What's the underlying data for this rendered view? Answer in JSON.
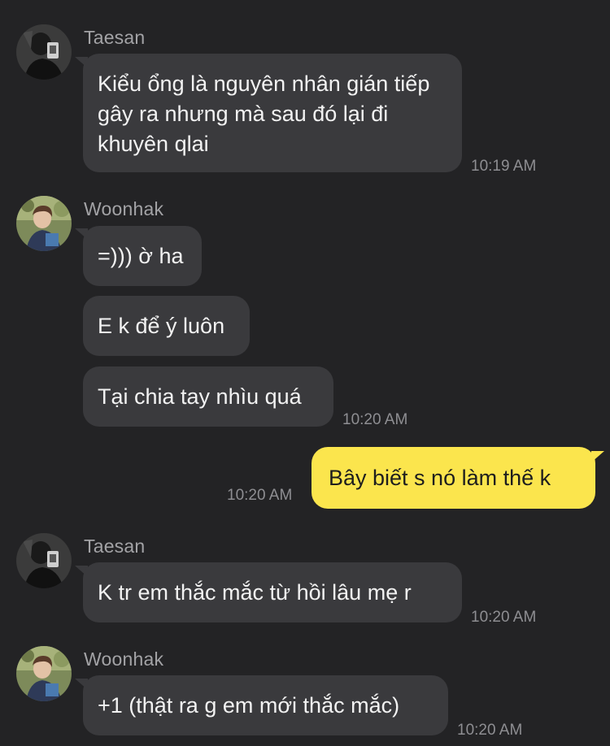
{
  "messages": [
    {
      "sender": "Taesan",
      "text": "Kiểu ổng là nguyên nhân gián tiếp gây ra nhưng mà sau đó lại đi khuyên qlai",
      "time": "10:19 AM"
    },
    {
      "sender": "Woonhak",
      "text": "=))) ờ ha"
    },
    {
      "text": "E k để ý luôn"
    },
    {
      "text": "Tại chia tay nhìu quá",
      "time": "10:20 AM"
    },
    {
      "sender": "me",
      "text": "Bây biết s nó làm thế k",
      "time": "10:20 AM"
    },
    {
      "sender": "Taesan",
      "text": "K tr em thắc mắc từ hồi lâu mẹ r",
      "time": "10:20 AM"
    },
    {
      "sender": "Woonhak",
      "text": "+1 (thật ra g em mới thắc mắc)",
      "time": "10:20 AM"
    }
  ],
  "colors": {
    "background": "#232325",
    "incoming_bubble": "#3a3a3d",
    "outgoing_bubble": "#fbe54d"
  },
  "icons": {
    "taesan_avatar": "profile-photo",
    "woonhak_avatar": "profile-photo"
  }
}
